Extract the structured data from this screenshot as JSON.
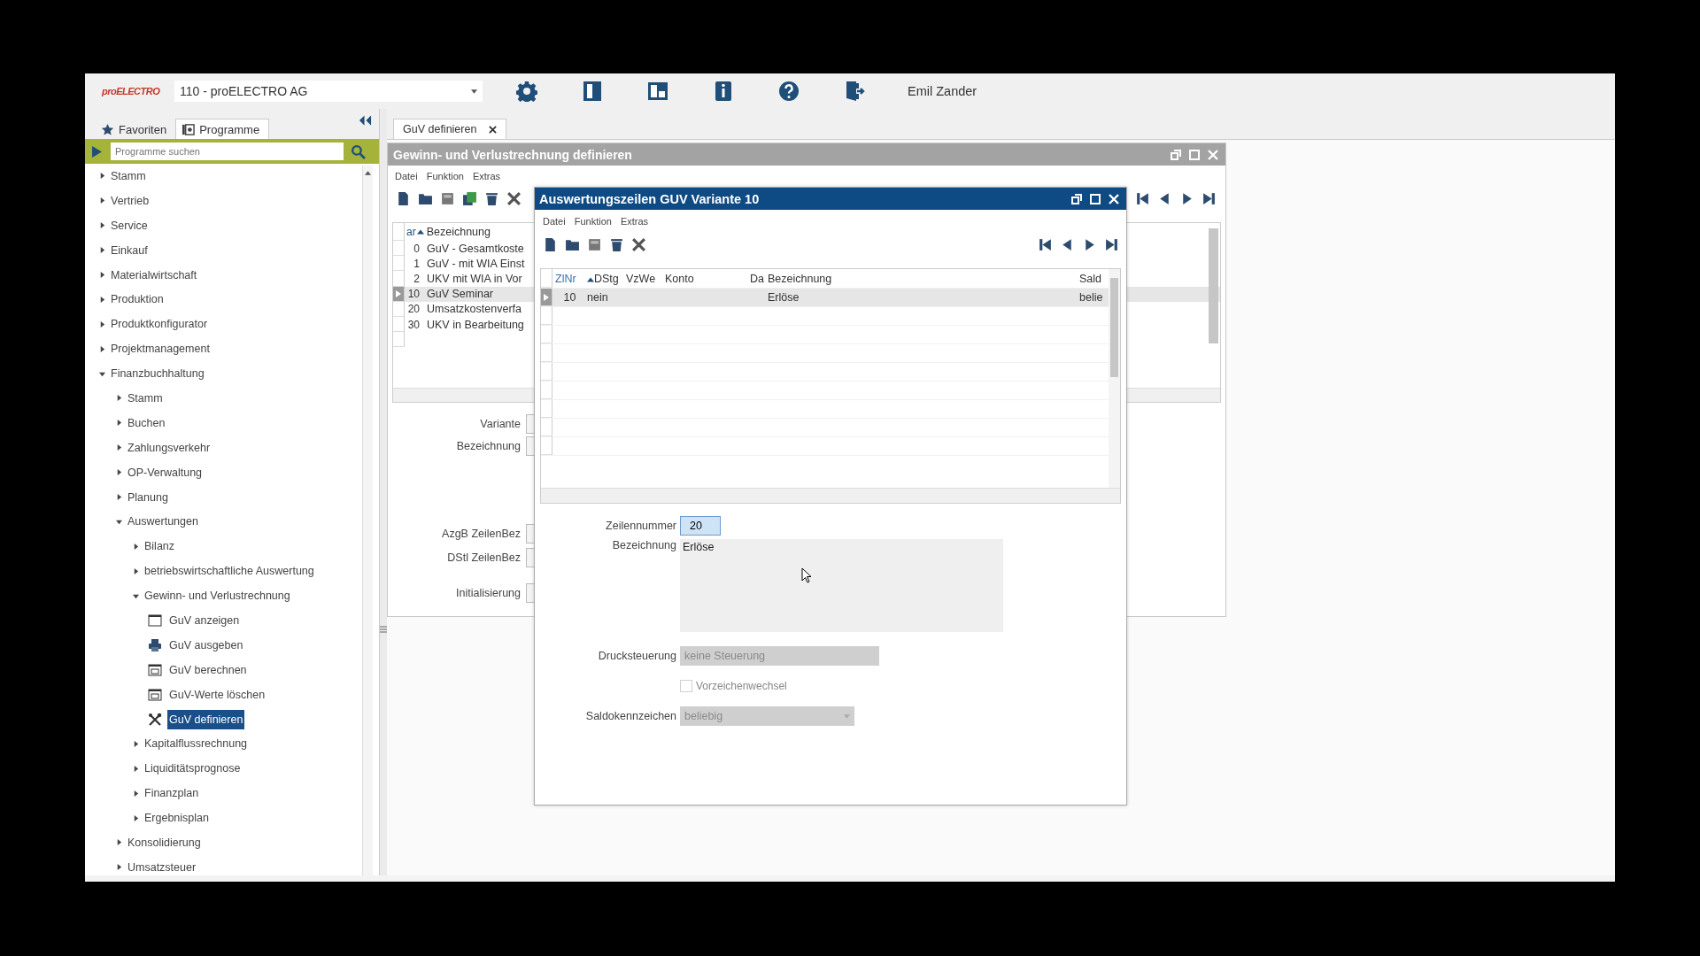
{
  "header": {
    "logo": "proELECTRO",
    "company": "110 - proELECTRO AG",
    "user": "Emil Zander"
  },
  "sidebar": {
    "tabs": [
      {
        "label": "Favoriten",
        "selected": false
      },
      {
        "label": "Programme",
        "selected": true
      }
    ],
    "search": {
      "placeholder": "Programme suchen"
    },
    "tree": [
      {
        "label": "Stamm",
        "expanded": false
      },
      {
        "label": "Vertrieb",
        "expanded": false
      },
      {
        "label": "Service",
        "expanded": false
      },
      {
        "label": "Einkauf",
        "expanded": false
      },
      {
        "label": "Materialwirtschaft",
        "expanded": false
      },
      {
        "label": "Produktion",
        "expanded": false
      },
      {
        "label": "Produktkonfigurator",
        "expanded": false
      },
      {
        "label": "Projektmanagement",
        "expanded": false
      },
      {
        "label": "Finanzbuchhaltung",
        "expanded": true,
        "children": [
          {
            "label": "Stamm",
            "expanded": false
          },
          {
            "label": "Buchen",
            "expanded": false
          },
          {
            "label": "Zahlungsverkehr",
            "expanded": false
          },
          {
            "label": "OP-Verwaltung",
            "expanded": false
          },
          {
            "label": "Planung",
            "expanded": false
          },
          {
            "label": "Auswertungen",
            "expanded": true,
            "children": [
              {
                "label": "Bilanz",
                "expanded": false
              },
              {
                "label": "betriebswirtschaftliche Auswertung",
                "expanded": false
              },
              {
                "label": "Gewinn- und Verlustrechnung",
                "expanded": true,
                "children": [
                  {
                    "label": "GuV anzeigen",
                    "selected": false
                  },
                  {
                    "label": "GuV ausgeben",
                    "selected": false
                  },
                  {
                    "label": "GuV berechnen",
                    "selected": false
                  },
                  {
                    "label": "GuV-Werte löschen",
                    "selected": false
                  },
                  {
                    "label": "GuV definieren",
                    "selected": true
                  }
                ]
              },
              {
                "label": "Kapitalflussrechnung",
                "expanded": false
              },
              {
                "label": "Liquiditätsprognose",
                "expanded": false
              },
              {
                "label": "Finanzplan",
                "expanded": false
              },
              {
                "label": "Ergebnisplan",
                "expanded": false
              }
            ]
          },
          {
            "label": "Konsolidierung",
            "expanded": false
          },
          {
            "label": "Umsatzsteuer",
            "expanded": false
          }
        ]
      }
    ]
  },
  "tabs": [
    {
      "label": "GuV definieren",
      "selected": true
    }
  ],
  "main_window": {
    "title": "Gewinn- und Verlustrechnung definieren",
    "menu": [
      "Datei",
      "Funktion",
      "Extras"
    ],
    "list": {
      "columns": [
        "ar",
        "Bezeichnung"
      ],
      "rows": [
        {
          "var": "0",
          "name": "GuV - Gesamtkoste",
          "selected": false
        },
        {
          "var": "1",
          "name": "GuV - mit WIA Einst",
          "selected": false
        },
        {
          "var": "2",
          "name": "UKV mit WIA in Vor",
          "selected": false
        },
        {
          "var": "10",
          "name": "GuV Seminar",
          "selected": true
        },
        {
          "var": "20",
          "name": "Umsatzkostenverfa",
          "selected": false
        },
        {
          "var": "30",
          "name": "UKV in Bearbeitung",
          "selected": false
        }
      ]
    },
    "form_labels": [
      "Variante",
      "Bezeichnung",
      "AzgB ZeilenBez",
      "DStl ZeilenBez",
      "Initialisierung"
    ]
  },
  "dialog": {
    "title": "Auswertungszeilen GUV Variante 10",
    "menu": [
      "Datei",
      "Funktion",
      "Extras"
    ],
    "grid": {
      "columns": [
        "ZlNr",
        "DStg",
        "VzWe",
        "Konto",
        "Da",
        "Bezeichnung",
        "Sald"
      ],
      "rows": [
        {
          "cells": [
            "10",
            "nein",
            "",
            "",
            "",
            "Erlöse",
            "belie"
          ],
          "selected": true
        }
      ]
    },
    "form": {
      "line_number": {
        "label": "Zeilennummer",
        "value": "20"
      },
      "description": {
        "label": "Bezeichnung",
        "value": "Erlöse"
      },
      "print_control": {
        "label": "Drucksteuerung",
        "value": "keine Steuerung",
        "disabled": true
      },
      "sign_change": {
        "label": "Vorzeichenwechsel",
        "checked": false,
        "disabled": true
      },
      "balance_flag": {
        "label": "Saldokennzeichen",
        "value": "beliebig",
        "disabled": true
      }
    }
  }
}
